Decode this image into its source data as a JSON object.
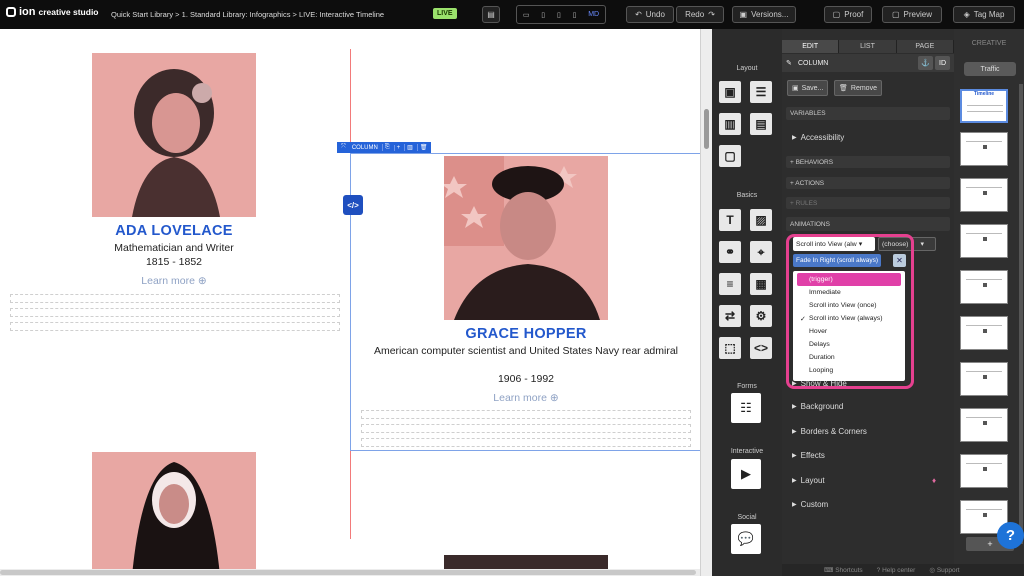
{
  "topbar": {
    "logo": "ion",
    "logo_sub": "creative studio",
    "breadcrumb": "Quick Start Library > 1. Standard Library: Infographics > LIVE: Interactive Timeline",
    "live_badge": "LIVE",
    "device_size": "MD",
    "undo": "Undo",
    "redo": "Redo",
    "versions": "Versions...",
    "proof": "Proof",
    "preview": "Preview",
    "tagmap": "Tag Map"
  },
  "timeline": {
    "people": [
      {
        "name": "ADA LOVELACE",
        "desc": "Mathematician and Writer",
        "years": "1815 - 1852",
        "learn": "Learn more"
      },
      {
        "name": "GRACE HOPPER",
        "desc": "American computer scientist and United States Navy rear admiral",
        "years": "1906 - 1992",
        "learn": "Learn more"
      }
    ],
    "column_label": "COLUMN"
  },
  "palette": {
    "layout": "Layout",
    "basics": "Basics",
    "forms": "Forms",
    "interactive": "Interactive",
    "social": "Social"
  },
  "panel": {
    "tabs": [
      "EDIT",
      "LIST",
      "PAGE"
    ],
    "header": "COLUMN",
    "id_btn": "ID",
    "save": "Save...",
    "remove": "Remove",
    "variables": "VARIABLES",
    "accessibility": "Accessibility",
    "behaviors": "+ BEHAVIORS",
    "actions": "+ ACTIONS",
    "rules": "+ RULES",
    "animations": "ANIMATIONS",
    "anim_trigger": "Scroll into View (alw",
    "anim_choose": "(choose)",
    "anim_tag": "Fade In Right (scroll always)",
    "dropdown": [
      "(trigger)",
      "Immediate",
      "Scroll into View (once)",
      "Scroll into View (always)",
      "Hover",
      "Delays",
      "Duration",
      "Looping"
    ],
    "show_hide": "Show & Hide",
    "background": "Background",
    "borders": "Borders & Corners",
    "effects": "Effects",
    "layout": "Layout",
    "custom": "Custom"
  },
  "creative": {
    "header": "CREATIVE",
    "traffic": "Traffic",
    "thumb_title": "Timeline",
    "add": "+"
  },
  "footer": {
    "shortcuts": "Shortcuts",
    "help": "Help center",
    "support": "Support"
  }
}
